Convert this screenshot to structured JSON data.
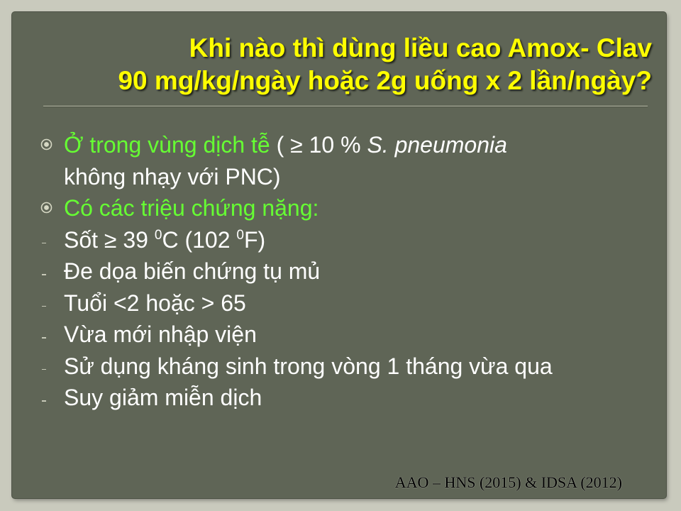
{
  "title": {
    "line1": "Khi nào thì dùng liều cao  Amox- Clav",
    "line2": "90 mg/kg/ngày  hoặc 2g uống x 2 lần/ngày?"
  },
  "bullets": [
    {
      "icon": "circled-dot-bullet-icon",
      "highlight": "Ở  trong vùng dịch tễ",
      "pre": " ( ≥ 10 % ",
      "italic": "S. pneumonia",
      "line2": "không nhạy với PNC)"
    },
    {
      "icon": "circled-dot-bullet-icon",
      "highlight": "Có các triệu chứng nặng:"
    }
  ],
  "symptoms": {
    "fever": {
      "a": "Sốt ≥ 39 ",
      "sup1": "0",
      "b": "C (102 ",
      "sup2": "0",
      "c": "F)"
    },
    "items": [
      "Đe dọa biến chứng tụ mủ",
      "Tuổi <2 hoặc > 65",
      "Vừa mới nhập viện",
      "Sử dụng kháng sinh trong vòng 1 tháng vừa qua",
      "Suy giảm miễn dịch"
    ]
  },
  "reference": "AAO – HNS (2015) & IDSA (2012)",
  "colors": {
    "background": "#5f6556",
    "title": "#ffff00",
    "highlight": "#66ff33",
    "text": "#ffffff"
  }
}
